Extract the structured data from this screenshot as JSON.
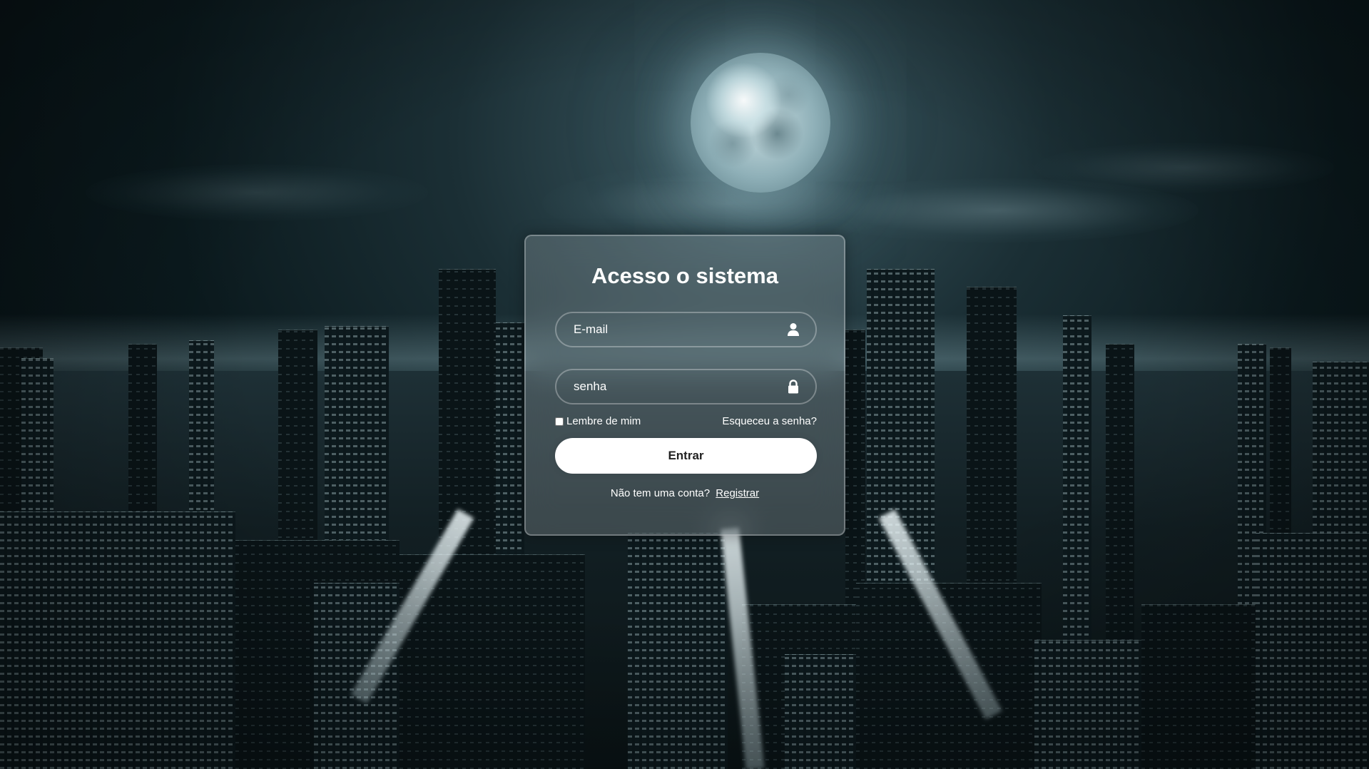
{
  "login": {
    "title": "Acesso o sistema",
    "email_placeholder": "E-mail",
    "password_placeholder": "senha",
    "remember_label": "Lembre de mim",
    "forgot_label": "Esqueceu a senha?",
    "submit_label": "Entrar",
    "no_account_text": "Não tem uma conta?",
    "register_label": "Registrar"
  },
  "icons": {
    "email": "user-icon",
    "password": "lock-icon"
  },
  "colors": {
    "button_bg": "#ffffff",
    "button_text": "#222222",
    "text": "#ffffff"
  }
}
